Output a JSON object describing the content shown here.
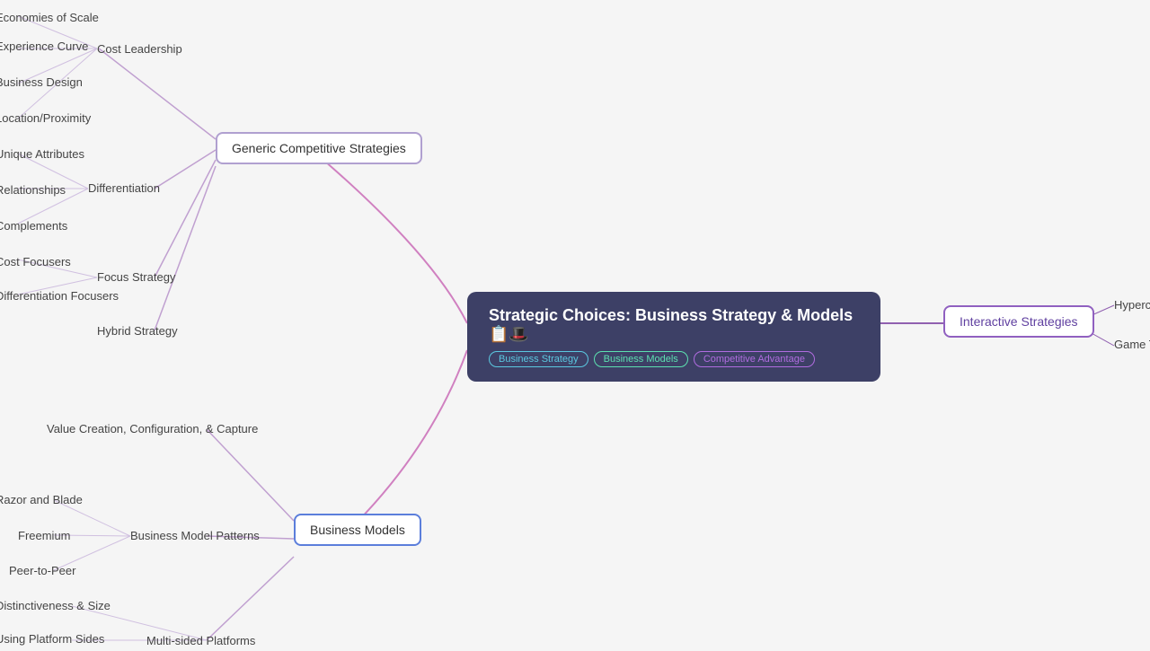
{
  "central": {
    "title": "Strategic Choices: Business Strategy & Models 📋🎩",
    "tags": [
      "Business Strategy",
      "Business Models",
      "Competitive Advantage"
    ]
  },
  "nodes": {
    "genericCompetitiveStrategies": "Generic Competitive Strategies",
    "businessModels": "Business Models",
    "interactiveStrategies": "Interactive Strategies",
    "costLeadership": "Cost Leadership",
    "differentiation": "Differentiation",
    "focusStrategy": "Focus Strategy",
    "hybridStrategy": "Hybrid Strategy",
    "economiesOfScale": "Economies of Scale",
    "experienceCurve": "Experience Curve",
    "businessDesign": "Business Design",
    "locationProximity": "Location/Proximity",
    "uniqueAttributes": "Unique Attributes",
    "relationships": "Relationships",
    "complements": "Complements",
    "costFocusers": "Cost Focusers",
    "differentiationFocusers": "Differentiation Focusers",
    "valueCreation": "Value Creation, Configuration, & Capture",
    "businessModelPatterns": "Business Model Patterns",
    "razorAndBlade": "Razor and Blade",
    "freemium": "Freemium",
    "peerToPeer": "Peer-to-Peer",
    "multiSidedPlatforms": "Multi-sided Platforms",
    "distinctiveness": "Distinctiveness & Size",
    "usingPlatformSides": "Using Platform Sides",
    "hypercompetition": "Hyperco...",
    "gameTheory": "Game T..."
  }
}
